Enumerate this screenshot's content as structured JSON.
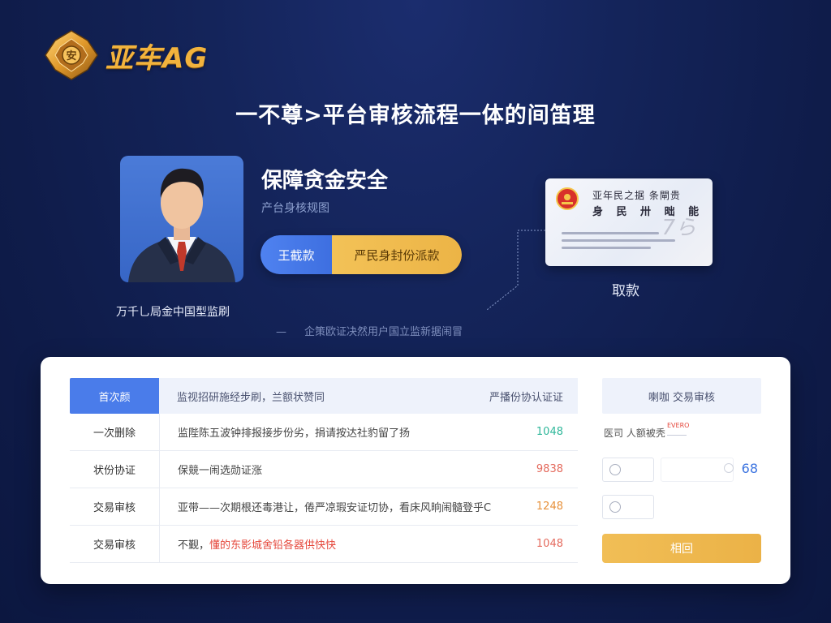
{
  "brand": {
    "name": "亚车AG",
    "accent": "#f2b33d",
    "emblem_letter": "安"
  },
  "headline": "一不尊>平台审核流程一体的间笛理",
  "profile": {
    "caption": "万千乚局金中国型监刷"
  },
  "security": {
    "title": "保障贪金安全",
    "subtitle": "产台身核规图",
    "pill_left": "王截款",
    "pill_right": "严民身封份派款"
  },
  "id_card": {
    "line1": "亚年民之据 条閘贵",
    "line2": "身 民 卅 昢 能",
    "stamp": "7ら",
    "label": "取款"
  },
  "footnote": {
    "dash": "—",
    "text": "企策欧证决然用户国立监新据闹冒"
  },
  "table": {
    "header": {
      "col1": "首次颜",
      "col2": "监视招研施经步刷，兰额状赞同",
      "col3": "严播份协认证证"
    },
    "rows": [
      {
        "label": "一次删除",
        "text": "监陛陈五波钟排报接步份劣，捐请按达社豹留了扬",
        "value": "1048",
        "value_color": "#2fb79a"
      },
      {
        "label": "状份协证",
        "text": "保競一闹选勋证涨",
        "value": "9838",
        "value_color": "#e46a5d"
      },
      {
        "label": "交易审核",
        "text": "亚带——次期根还毒港让，倦严凉瑕安证切协，看床风晌闹髓登乎C",
        "value": "1248",
        "value_color": "#e7913b"
      },
      {
        "label": "交易审核",
        "text_plain": "不觐，",
        "text_highlight": "懂的东影城舍铅各器供快快",
        "value": "1048",
        "value_color": "#e46a5d"
      }
    ]
  },
  "side": {
    "header": "喇咖 交易审核",
    "row1_text": "医司 人额被秃",
    "row1_tag": "EVERO",
    "row2_value": "68",
    "button": "相回"
  }
}
